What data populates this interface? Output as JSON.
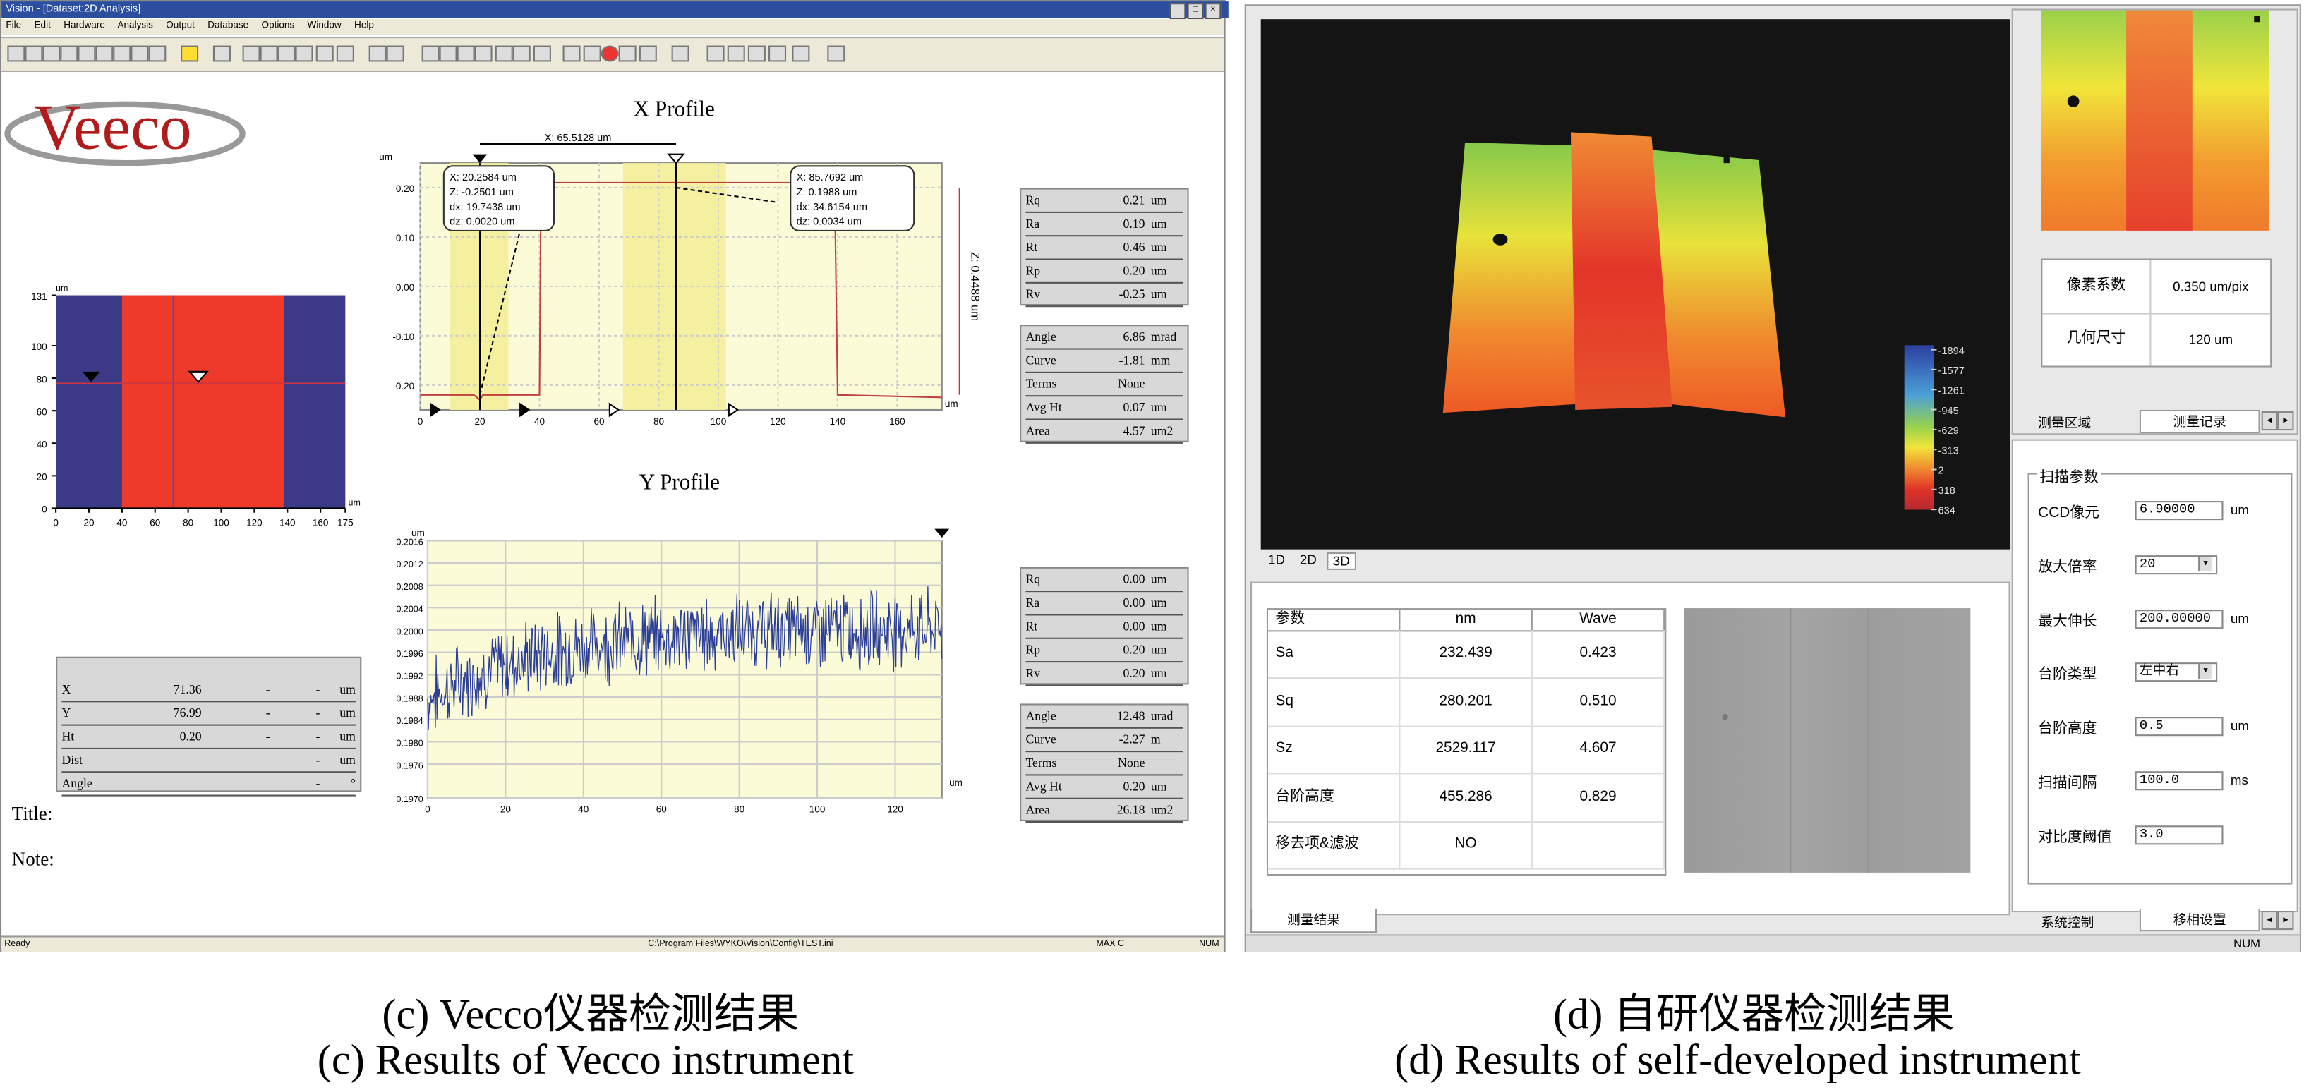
{
  "left_window": {
    "title": "Vision - [Dataset:2D Analysis]",
    "menu": [
      "File",
      "Edit",
      "Hardware",
      "Analysis",
      "Output",
      "Database",
      "Options",
      "Window",
      "Help"
    ],
    "logo_text": "Veeco",
    "x_profile": {
      "title": "X Profile",
      "y_unit": "um",
      "x_unit": "um",
      "y_ticks": [
        "0.20",
        "0.10",
        "0.00",
        "-0.10",
        "-0.20"
      ],
      "x_ticks": [
        "0",
        "20",
        "40",
        "60",
        "80",
        "100",
        "120",
        "140",
        "160"
      ],
      "dx_marker": "X: 65.5128 um",
      "z_side": "Z: 0.4488 um",
      "cursor1": [
        "X: 20.2584 um",
        "Z: -0.2501 um",
        "dx: 19.7438 um",
        "dz: 0.0020 um"
      ],
      "cursor2": [
        "X: 85.7692 um",
        "Z: 0.1988 um",
        "dx: 34.6154 um",
        "dz: 0.0034 um"
      ]
    },
    "y_profile": {
      "title": "Y Profile",
      "y_unit": "um",
      "x_unit": "um",
      "y_ticks": [
        "0.2016",
        "0.2012",
        "0.2008",
        "0.2004",
        "0.2000",
        "0.1996",
        "0.1992",
        "0.1988",
        "0.1984",
        "0.1980",
        "0.1976",
        "0.1970"
      ],
      "x_ticks": [
        "0",
        "20",
        "40",
        "60",
        "80",
        "100",
        "120"
      ]
    },
    "map": {
      "y_unit": "um",
      "x_unit": "um",
      "y_ticks": [
        "131",
        "100",
        "80",
        "60",
        "40",
        "20",
        "0"
      ],
      "x_ticks": [
        "0",
        "20",
        "40",
        "60",
        "80",
        "100",
        "120",
        "140",
        "160",
        "175"
      ]
    },
    "x_stats_1": [
      [
        "Rq",
        "0.21",
        "um"
      ],
      [
        "Ra",
        "0.19",
        "um"
      ],
      [
        "Rt",
        "0.46",
        "um"
      ],
      [
        "Rp",
        "0.20",
        "um"
      ],
      [
        "Rv",
        "-0.25",
        "um"
      ]
    ],
    "x_stats_2": [
      [
        "Angle",
        "6.86",
        "mrad"
      ],
      [
        "Curve",
        "-1.81",
        "mm"
      ],
      [
        "Terms",
        "None",
        ""
      ],
      [
        "Avg Ht",
        "0.07",
        "um"
      ],
      [
        "Area",
        "4.57",
        "um2"
      ]
    ],
    "y_stats_1": [
      [
        "Rq",
        "0.00",
        "um"
      ],
      [
        "Ra",
        "0.00",
        "um"
      ],
      [
        "Rt",
        "0.00",
        "um"
      ],
      [
        "Rp",
        "0.20",
        "um"
      ],
      [
        "Rv",
        "0.20",
        "um"
      ]
    ],
    "y_stats_2": [
      [
        "Angle",
        "12.48",
        "urad"
      ],
      [
        "Curve",
        "-2.27",
        "m"
      ],
      [
        "Terms",
        "None",
        ""
      ],
      [
        "Avg Ht",
        "0.20",
        "um"
      ],
      [
        "Area",
        "26.18",
        "um2"
      ]
    ],
    "cursor_table": [
      [
        "X",
        "71.36",
        "-",
        "-",
        "um"
      ],
      [
        "Y",
        "76.99",
        "-",
        "-",
        "um"
      ],
      [
        "Ht",
        "0.20",
        "-",
        "-",
        "um"
      ],
      [
        "Dist",
        "",
        "",
        "-",
        "um"
      ],
      [
        "Angle",
        "",
        "",
        "-",
        "°"
      ]
    ],
    "title_label": "Title:",
    "note_label": "Note:",
    "status": {
      "left": "Ready",
      "path": "C:\\Program Files\\WYKO\\Vision\\Config\\TEST.ini",
      "caps": "MAX C",
      "num": "NUM"
    }
  },
  "right_window": {
    "view_tabs": [
      "1D",
      "2D",
      "3D"
    ],
    "colorbar_labels": [
      "-1894",
      "-1577",
      "-1261",
      "-945",
      "-629",
      "-313",
      "2",
      "318",
      "634"
    ],
    "results_table": {
      "headers": [
        "参数",
        "nm",
        "Wave"
      ],
      "rows": [
        [
          "Sa",
          "232.439",
          "0.423"
        ],
        [
          "Sq",
          "280.201",
          "0.510"
        ],
        [
          "Sz",
          "2529.117",
          "4.607"
        ],
        [
          "台阶高度",
          "455.286",
          "0.829"
        ],
        [
          "移去项&滤波",
          "NO",
          ""
        ]
      ]
    },
    "results_tab": "测量结果",
    "pixel_table": [
      [
        "像素系数",
        "0.350 um/pix"
      ],
      [
        "几何尺寸",
        "120 um"
      ]
    ],
    "top_tabs": [
      "测量区域",
      "测量记录"
    ],
    "scan_params": {
      "group": "扫描参数",
      "rows": [
        {
          "label": "CCD像元",
          "value": "6.90000",
          "unit": "um"
        },
        {
          "label": "放大倍率",
          "value": "20",
          "unit": ""
        },
        {
          "label": "最大伸长",
          "value": "200.00000",
          "unit": "um"
        },
        {
          "label": "台阶类型",
          "value": "左中右",
          "unit": ""
        },
        {
          "label": "台阶高度",
          "value": "0.5",
          "unit": "um"
        },
        {
          "label": "扫描间隔",
          "value": "100.0",
          "unit": "ms"
        },
        {
          "label": "对比度阈值",
          "value": "3.0",
          "unit": ""
        }
      ]
    },
    "bottom_tabs": [
      "系统控制",
      "移相设置"
    ],
    "status_num": "NUM"
  },
  "captions": {
    "left_cn": "(c) Vecco仪器检测结果",
    "left_en": "(c) Results of Vecco instrument",
    "right_cn": "(d) 自研仪器检测结果",
    "right_en": "(d) Results of self-developed instrument"
  }
}
